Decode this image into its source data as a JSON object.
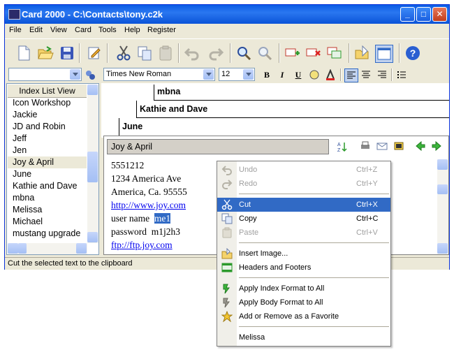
{
  "window": {
    "title": "Card 2000 - C:\\Contacts\\tony.c2k"
  },
  "menu": [
    "File",
    "Edit",
    "View",
    "Card",
    "Tools",
    "Help",
    "Register"
  ],
  "toolbar": {
    "font_name": "Times New Roman",
    "font_size": "12",
    "bold": "B",
    "italic": "I",
    "underline": "U"
  },
  "index_list": {
    "header": "Index List View",
    "items": [
      "Icon Workshop",
      "Jackie",
      "JD and Robin",
      "Jeff",
      "Jen",
      "Joy & April",
      "June",
      "Kathie and Dave",
      "mbna",
      "Melissa",
      "Michael",
      "mustang upgrade"
    ],
    "selected": "Joy & April"
  },
  "card_tabs": [
    "mbna",
    "Kathie and Dave",
    "June"
  ],
  "card": {
    "title": "Joy & April",
    "lines": [
      "5551212",
      "1234 America Ave",
      "America, Ca. 95555",
      "http://www.joy.com",
      "user name",
      "me1",
      "password  m1j2h3",
      "ftp://ftp.joy.com"
    ]
  },
  "status": "Cut the selected text to the clipboard",
  "context_menu": {
    "undo": {
      "label": "Undo",
      "shortcut": "Ctrl+Z"
    },
    "redo": {
      "label": "Redo",
      "shortcut": "Ctrl+Y"
    },
    "cut": {
      "label": "Cut",
      "shortcut": "Ctrl+X"
    },
    "copy": {
      "label": "Copy",
      "shortcut": "Ctrl+C"
    },
    "paste": {
      "label": "Paste",
      "shortcut": "Ctrl+V"
    },
    "insert_image": "Insert Image...",
    "headers_footers": "Headers and Footers",
    "index_format": "Apply Index Format to All",
    "body_format": "Apply Body Format to All",
    "favorite": "Add or Remove as a Favorite",
    "recent": "Melissa"
  },
  "colors": {
    "title_blue": "#0a5be4",
    "selection": "#316ac5",
    "link": "#0000ee"
  }
}
